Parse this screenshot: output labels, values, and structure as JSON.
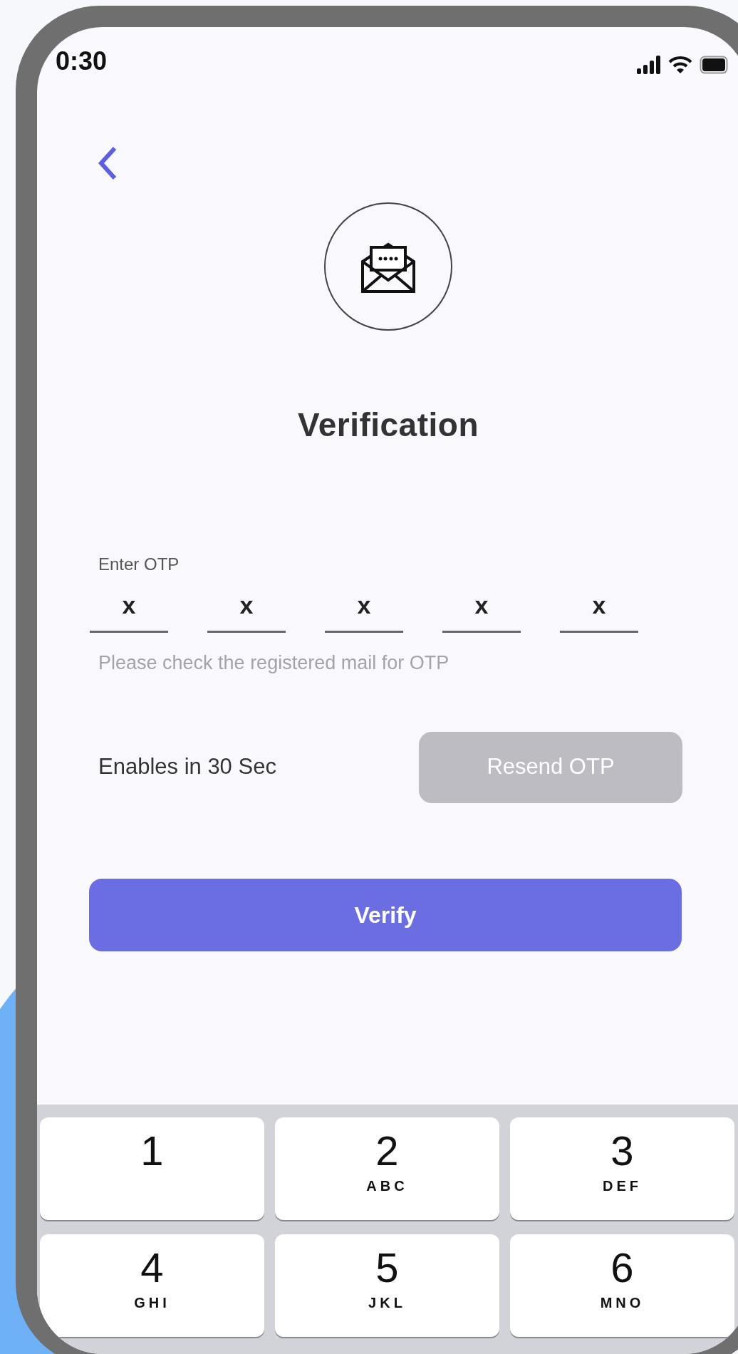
{
  "status_bar": {
    "time": "0:30"
  },
  "title": "Verification",
  "otp": {
    "label": "Enter OTP",
    "fields": [
      {
        "value": "x"
      },
      {
        "value": "x"
      },
      {
        "value": "x"
      },
      {
        "value": "x"
      },
      {
        "value": "x"
      }
    ],
    "hint": "Please check the registered mail for OTP"
  },
  "resend": {
    "timer": "Enables in 30 Sec",
    "button": "Resend OTP",
    "disabled": true
  },
  "verify_button": "Verify",
  "keypad": [
    {
      "digit": "1"
    },
    {
      "digit": "2",
      "letters": "ABC"
    },
    {
      "digit": "3",
      "letters": "DEF"
    },
    {
      "digit": "4",
      "letters": "GHI"
    },
    {
      "digit": "5",
      "letters": "JKL"
    },
    {
      "digit": "6",
      "letters": "MNO"
    }
  ]
}
